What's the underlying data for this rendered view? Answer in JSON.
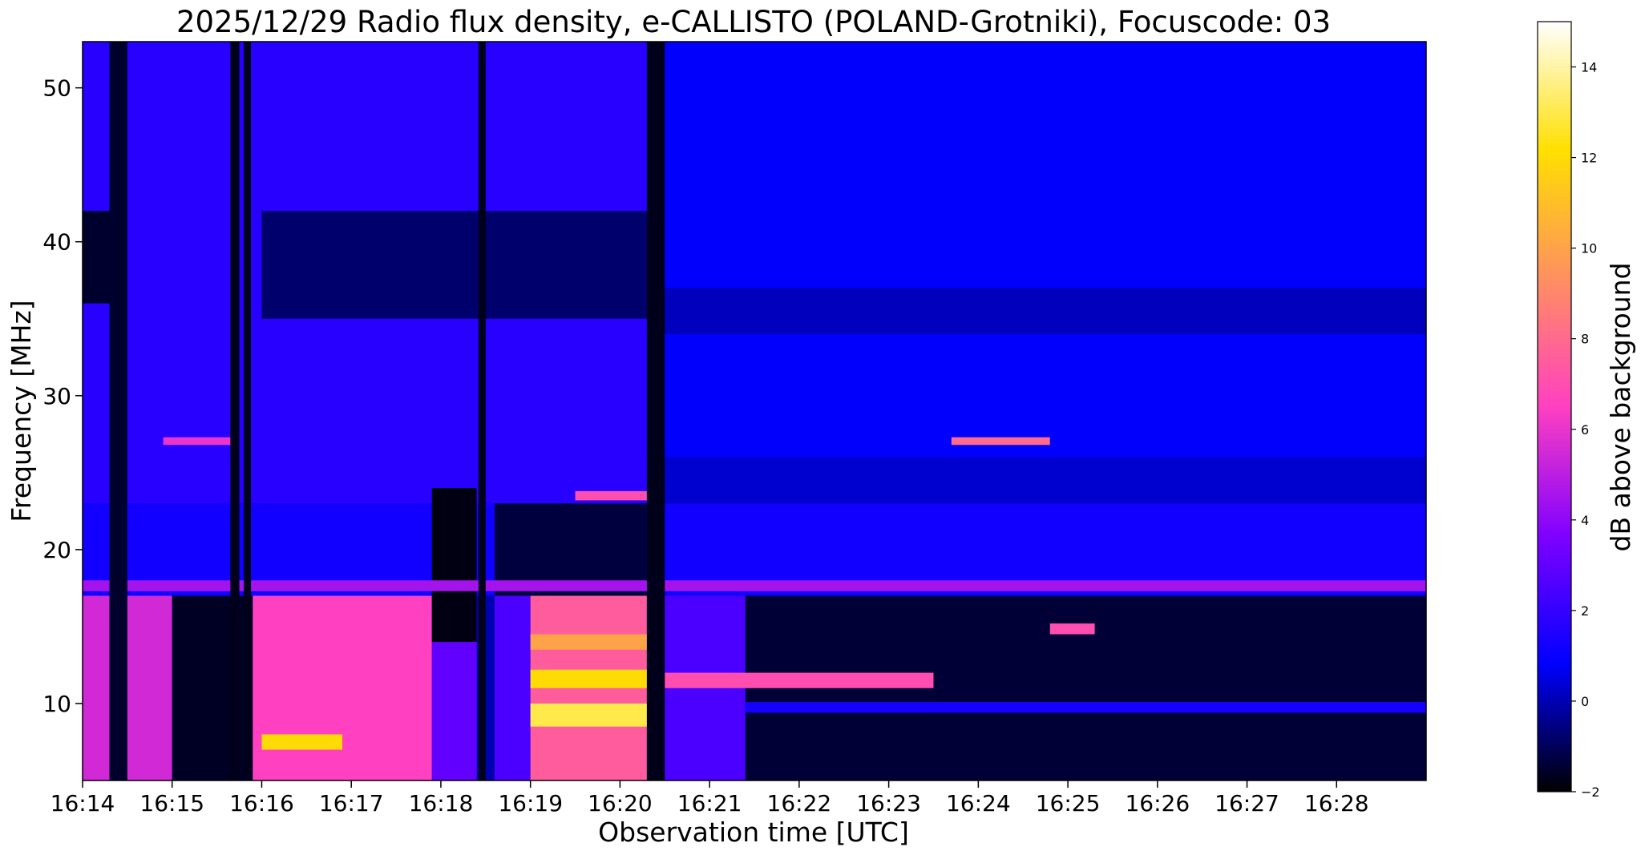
{
  "chart_data": {
    "type": "heatmap",
    "title": "2025/12/29  Radio flux density, e-CALLISTO (POLAND-Grotniki), Focuscode: 03",
    "xlabel": "Observation time [UTC]",
    "ylabel": "Frequency [MHz]",
    "colorbar_label": "dB above background",
    "x_range_minutes": [
      0,
      15
    ],
    "x_ticks": [
      {
        "minute": 0,
        "label": "16:14"
      },
      {
        "minute": 1,
        "label": "16:15"
      },
      {
        "minute": 2,
        "label": "16:16"
      },
      {
        "minute": 3,
        "label": "16:17"
      },
      {
        "minute": 4,
        "label": "16:18"
      },
      {
        "minute": 5,
        "label": "16:19"
      },
      {
        "minute": 6,
        "label": "16:20"
      },
      {
        "minute": 7,
        "label": "16:21"
      },
      {
        "minute": 8,
        "label": "16:22"
      },
      {
        "minute": 9,
        "label": "16:23"
      },
      {
        "minute": 10,
        "label": "16:24"
      },
      {
        "minute": 11,
        "label": "16:25"
      },
      {
        "minute": 12,
        "label": "16:26"
      },
      {
        "minute": 13,
        "label": "16:27"
      },
      {
        "minute": 14,
        "label": "16:28"
      }
    ],
    "ylim": [
      5,
      53
    ],
    "y_ticks": [
      {
        "value": 10,
        "label": "10"
      },
      {
        "value": 20,
        "label": "20"
      },
      {
        "value": 30,
        "label": "30"
      },
      {
        "value": 40,
        "label": "40"
      },
      {
        "value": 50,
        "label": "50"
      }
    ],
    "colorbar_range": [
      -2,
      15
    ],
    "colorbar_ticks": [
      {
        "value": -2,
        "label": "−2"
      },
      {
        "value": 0,
        "label": "0"
      },
      {
        "value": 2,
        "label": "2"
      },
      {
        "value": 4,
        "label": "4"
      },
      {
        "value": 6,
        "label": "6"
      },
      {
        "value": 8,
        "label": "8"
      },
      {
        "value": 10,
        "label": "10"
      },
      {
        "value": 12,
        "label": "12"
      },
      {
        "value": 14,
        "label": "14"
      }
    ],
    "colormap": [
      "#000000",
      "#0000ff",
      "#8000ff",
      "#ff40c0",
      "#ff9060",
      "#ffe000",
      "#ffffff"
    ],
    "bands": [
      {
        "t0": 0,
        "t1": 6.3,
        "f0": 23,
        "f1": 53,
        "db": 1.7
      },
      {
        "t0": 6.3,
        "t1": 15,
        "f0": 23,
        "f1": 53,
        "db": 0.8
      },
      {
        "t0": 0,
        "t1": 15,
        "f0": 17,
        "f1": 23,
        "db": 1.2
      },
      {
        "t0": 2,
        "t1": 6.3,
        "f0": 35,
        "f1": 42,
        "db": -0.8
      },
      {
        "t0": 0,
        "t1": 0.3,
        "f0": 36,
        "f1": 42,
        "db": -1.5
      },
      {
        "t0": 6.3,
        "t1": 15,
        "f0": 34,
        "f1": 37,
        "db": 0.1
      },
      {
        "t0": 6.3,
        "t1": 15,
        "f0": 23,
        "f1": 26,
        "db": 0.3
      },
      {
        "t0": 0,
        "t1": 1,
        "f0": 5,
        "f1": 17,
        "db": 5.5
      },
      {
        "t0": 1,
        "t1": 1.9,
        "f0": 5,
        "f1": 17,
        "db": -1.6
      },
      {
        "t0": 1.9,
        "t1": 3.9,
        "f0": 5,
        "f1": 17,
        "db": 6.5
      },
      {
        "t0": 3.9,
        "t1": 4.4,
        "f0": 5,
        "f1": 17,
        "db": 3
      },
      {
        "t0": 4.6,
        "t1": 5,
        "f0": 5,
        "f1": 17,
        "db": 2.5
      },
      {
        "t0": 5,
        "t1": 6.3,
        "f0": 5,
        "f1": 17,
        "db": 7.5
      },
      {
        "t0": 6.3,
        "t1": 7.4,
        "f0": 5,
        "f1": 17,
        "db": 2.5
      },
      {
        "t0": 7.4,
        "t1": 15,
        "f0": 5,
        "f1": 17,
        "db": -1.4
      },
      {
        "t0": 3.9,
        "t1": 4.4,
        "f0": 14,
        "f1": 24,
        "db": -1.8
      },
      {
        "t0": 4.6,
        "t1": 6.3,
        "f0": 17,
        "f1": 23,
        "db": -1.3
      },
      {
        "t0": 5,
        "t1": 6.3,
        "f0": 8.5,
        "f1": 10,
        "db": 13
      },
      {
        "t0": 5,
        "t1": 6.3,
        "f0": 11,
        "f1": 12.2,
        "db": 12
      },
      {
        "t0": 5,
        "t1": 6.3,
        "f0": 13.5,
        "f1": 14.5,
        "db": 10
      },
      {
        "t0": 5.5,
        "t1": 6.3,
        "f0": 23.2,
        "f1": 23.8,
        "db": 7
      },
      {
        "t0": 2,
        "t1": 2.9,
        "f0": 7,
        "f1": 8,
        "db": 12
      },
      {
        "t0": 6.3,
        "t1": 9.5,
        "f0": 11,
        "f1": 12,
        "db": 7
      },
      {
        "t0": 0.9,
        "t1": 1.7,
        "f0": 26.8,
        "f1": 27.3,
        "db": 6
      },
      {
        "t0": 9.7,
        "t1": 10.8,
        "f0": 26.8,
        "f1": 27.3,
        "db": 8
      },
      {
        "t0": 0,
        "t1": 15,
        "f0": 17.3,
        "f1": 18,
        "db": 4.5
      },
      {
        "t0": 10.8,
        "t1": 11.3,
        "f0": 14.5,
        "f1": 15.2,
        "db": 7
      },
      {
        "t0": 7.4,
        "t1": 15,
        "f0": 9.4,
        "f1": 10.1,
        "db": 1.3
      },
      {
        "t0": 0.3,
        "t1": 0.5,
        "f0": 5,
        "f1": 53,
        "db": -1.5
      },
      {
        "t0": 1.65,
        "t1": 1.75,
        "f0": 5,
        "f1": 53,
        "db": -1.7
      },
      {
        "t0": 1.8,
        "t1": 1.88,
        "f0": 5,
        "f1": 53,
        "db": -1.7
      },
      {
        "t0": 4.42,
        "t1": 4.5,
        "f0": 5,
        "f1": 53,
        "db": -1.7
      },
      {
        "t0": 6.3,
        "t1": 6.5,
        "f0": 5,
        "f1": 53,
        "db": -1.7
      }
    ]
  }
}
